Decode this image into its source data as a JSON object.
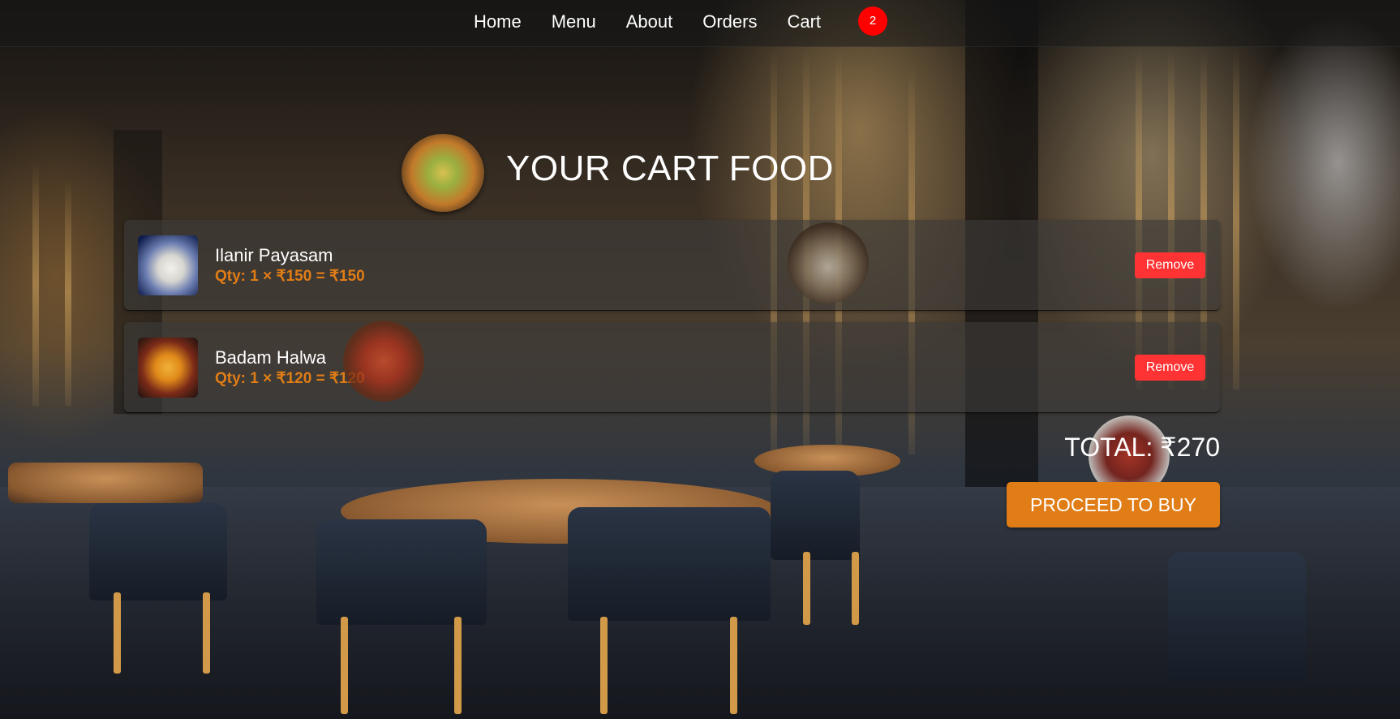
{
  "nav": {
    "links": [
      {
        "label": "Home"
      },
      {
        "label": "Menu"
      },
      {
        "label": "About"
      },
      {
        "label": "Orders"
      },
      {
        "label": "Cart"
      }
    ],
    "cart_count": "2"
  },
  "page": {
    "title": "YOUR CART FOOD"
  },
  "cart": {
    "items": [
      {
        "name": "Ilanir Payasam",
        "qty_line": "Qty: 1 × ₹150 = ₹150",
        "remove_label": "Remove"
      },
      {
        "name": "Badam Halwa",
        "qty_line": "Qty: 1 × ₹120 = ₹120",
        "remove_label": "Remove"
      }
    ],
    "total": "TOTAL: ₹270",
    "buy_label": "PROCEED TO BUY"
  },
  "colors": {
    "accent": "#e07d16",
    "remove": "#ff3333",
    "badge": "#ff0000",
    "text": "#ffffff"
  }
}
